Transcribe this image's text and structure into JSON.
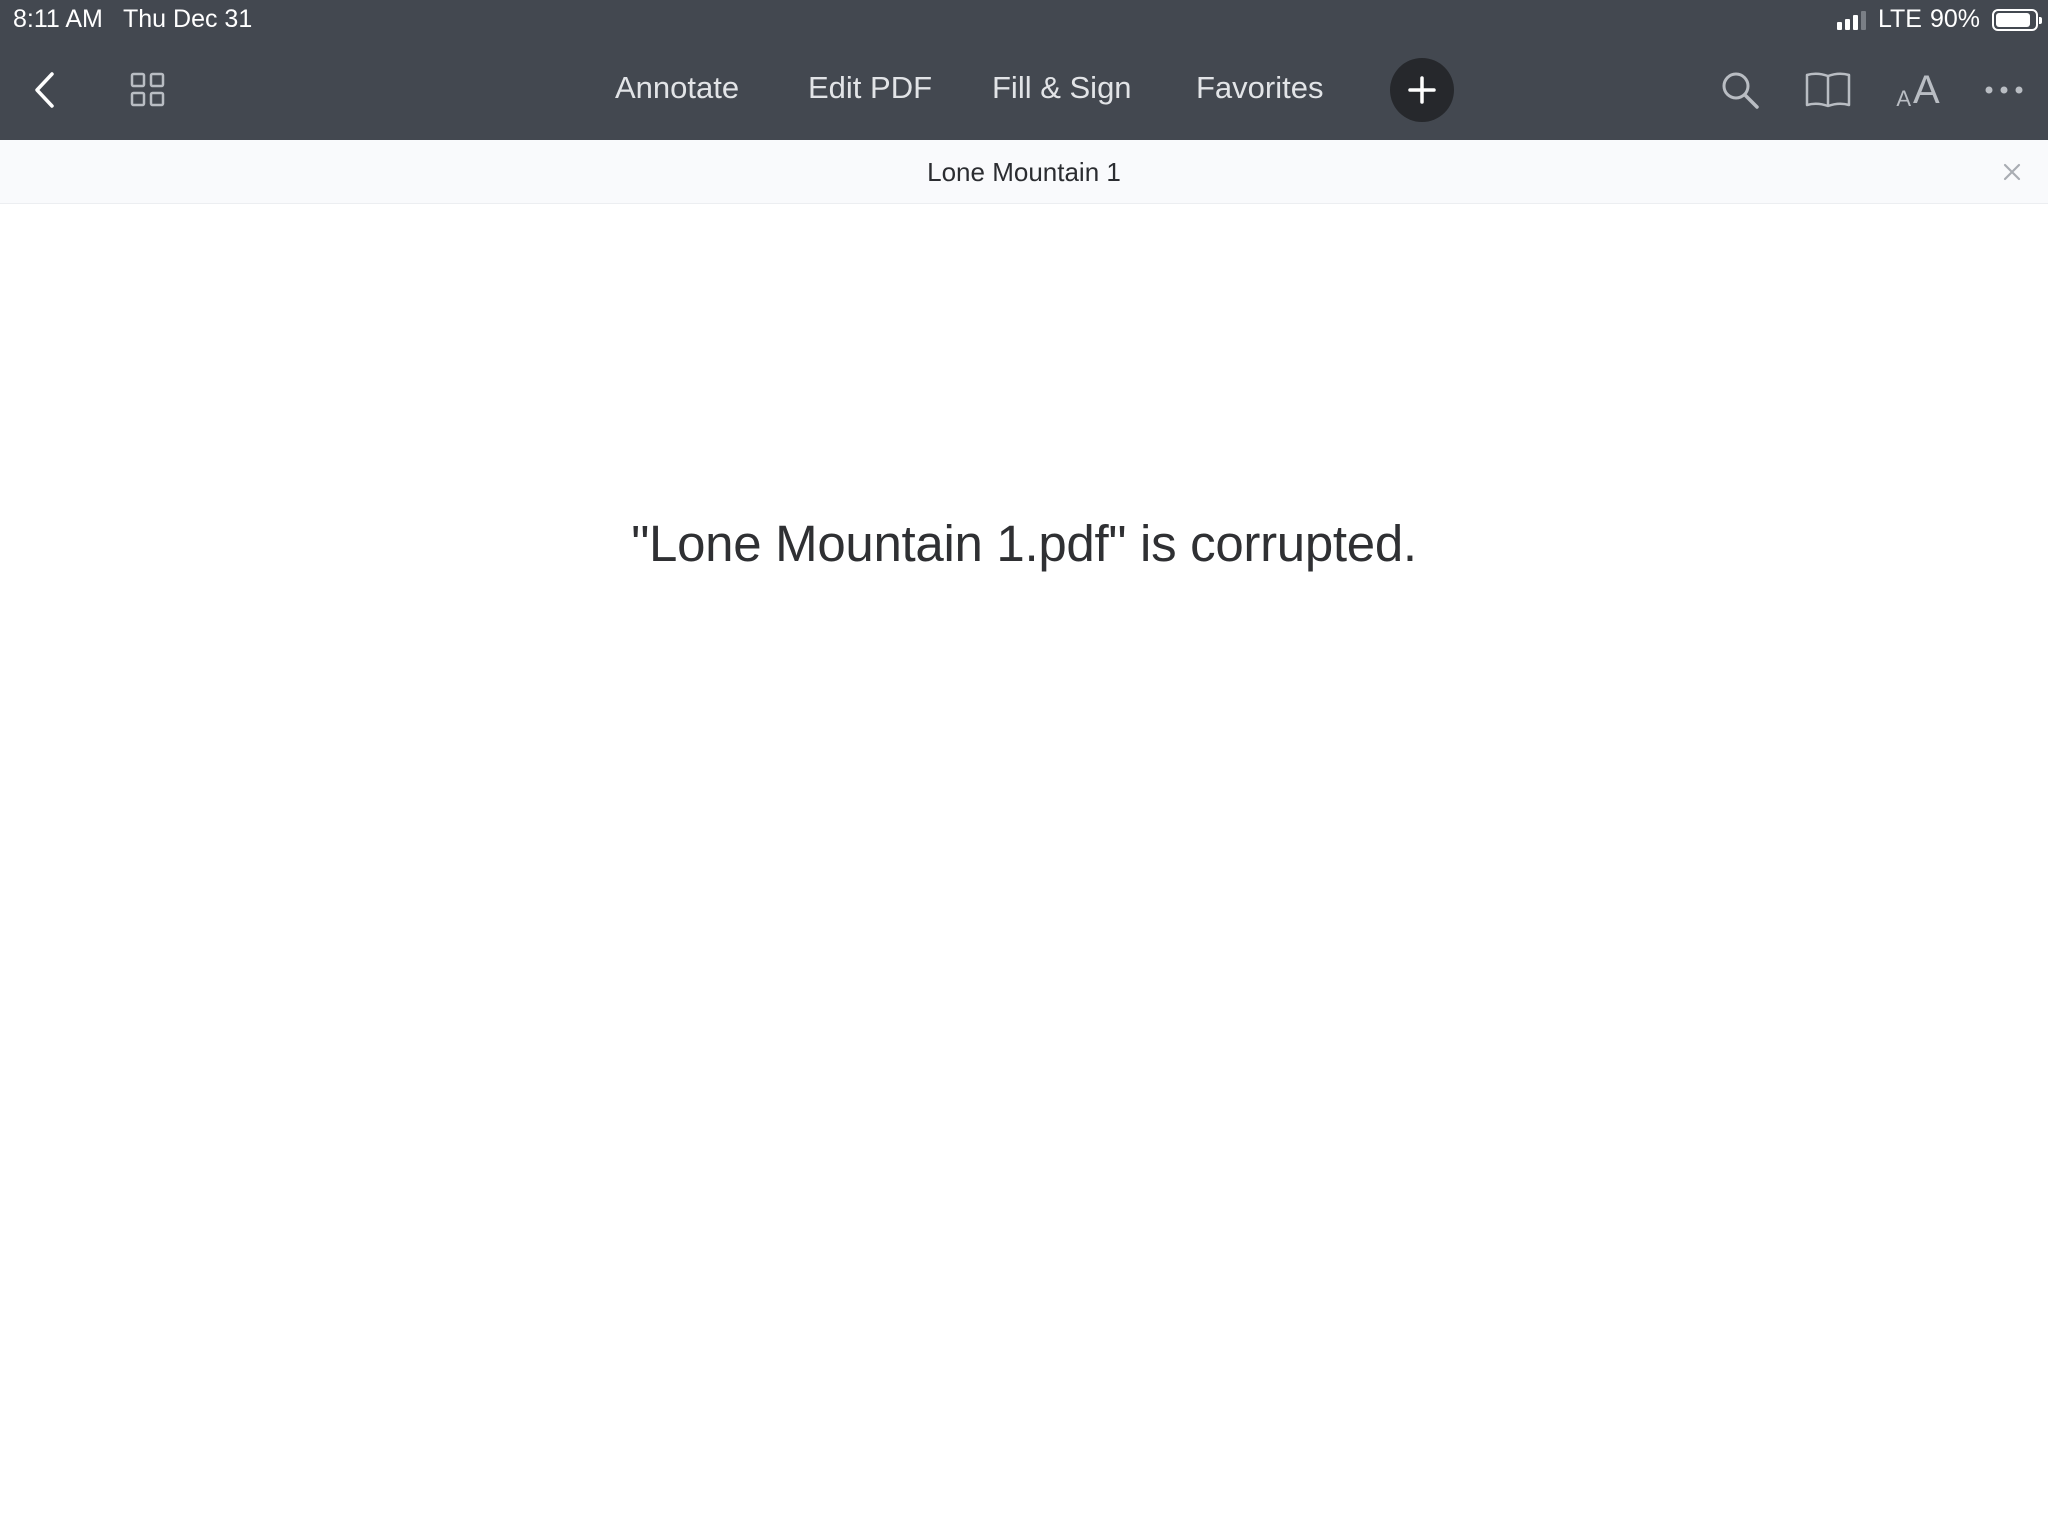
{
  "status_bar": {
    "time": "8:11 AM",
    "date": "Thu Dec 31",
    "network": "LTE",
    "battery": "90%",
    "battery_level": 0.9
  },
  "toolbar": {
    "back_icon": "chevron-left-icon",
    "grid_icon": "grid-icon",
    "tabs": [
      {
        "label": "Annotate"
      },
      {
        "label": "Edit PDF"
      },
      {
        "label": "Fill & Sign"
      },
      {
        "label": "Favorites"
      }
    ],
    "add_icon": "plus-icon",
    "search_icon": "search-icon",
    "book_icon": "book-icon",
    "text_size_icon": "text-size-icon",
    "text_size_glyph_small": "A",
    "text_size_glyph_large": "A",
    "more_icon": "more-icon"
  },
  "document": {
    "title": "Lone Mountain 1",
    "close_icon": "close-icon",
    "message": "\"Lone Mountain 1.pdf\" is corrupted."
  },
  "colors": {
    "chrome_background": "#434850",
    "titlebar_background": "#f9fafc",
    "add_button_background": "#26282c",
    "text_primary": "#2f3033"
  }
}
